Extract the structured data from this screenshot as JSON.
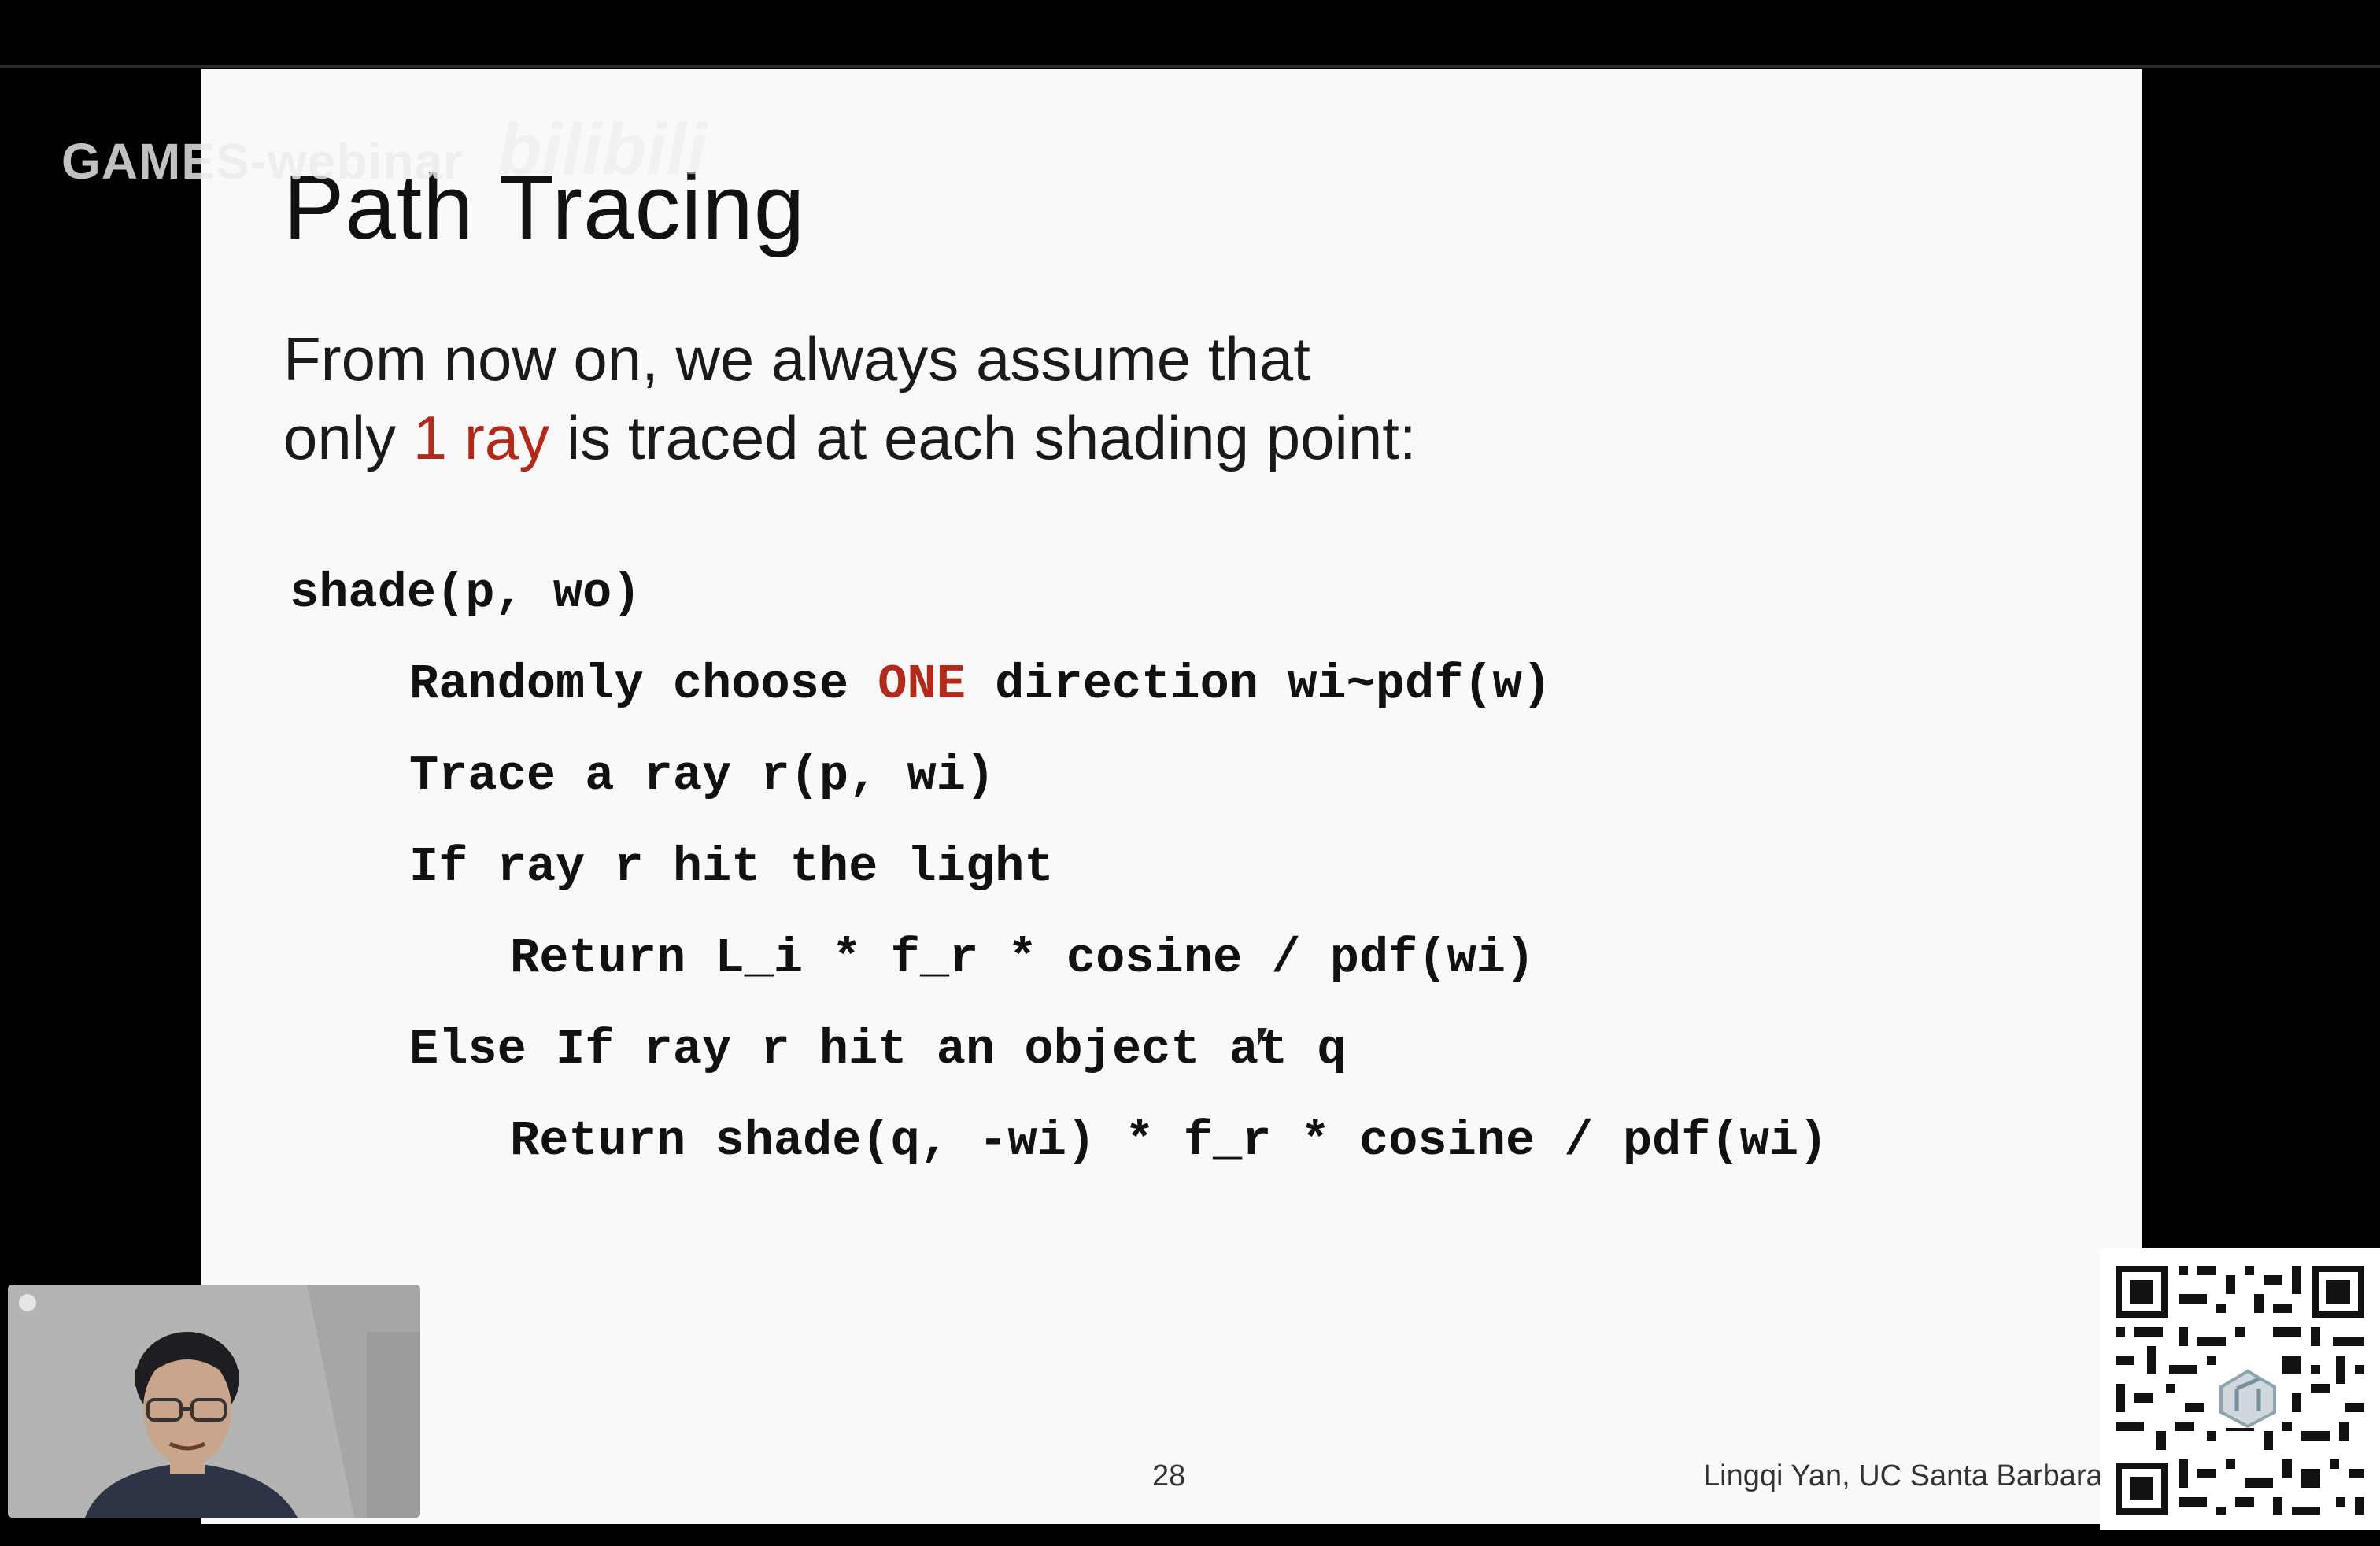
{
  "watermark": {
    "text": "GAMES-webinar",
    "logo_text": "bilibili"
  },
  "slide": {
    "title": "Path Tracing",
    "intro": {
      "line1": "From now on, we always assume that",
      "line2_before": "only ",
      "line2_highlight": "1 ray",
      "line2_after": " is traced at each shading point:"
    },
    "code": {
      "line1": "shade(p, wo)",
      "line2_before": "Randomly choose ",
      "line2_keyword": "ONE",
      "line2_after": " direction wi~pdf(w)",
      "line3": "Trace a ray r(p, wi)",
      "line4": "If ray r hit the light",
      "line5": "Return L_i * f_r * cosine / pdf(wi)",
      "line6": "Else If ray r hit an object at q",
      "line7": "Return shade(q, -wi) * f_r * cosine / pdf(wi)"
    },
    "page_number": "28",
    "author": "Lingqi Yan, UC Santa Barbara"
  },
  "colors": {
    "accent": "#b32a1a",
    "slide_background": "#f9f9f9",
    "frame": "#000000"
  }
}
